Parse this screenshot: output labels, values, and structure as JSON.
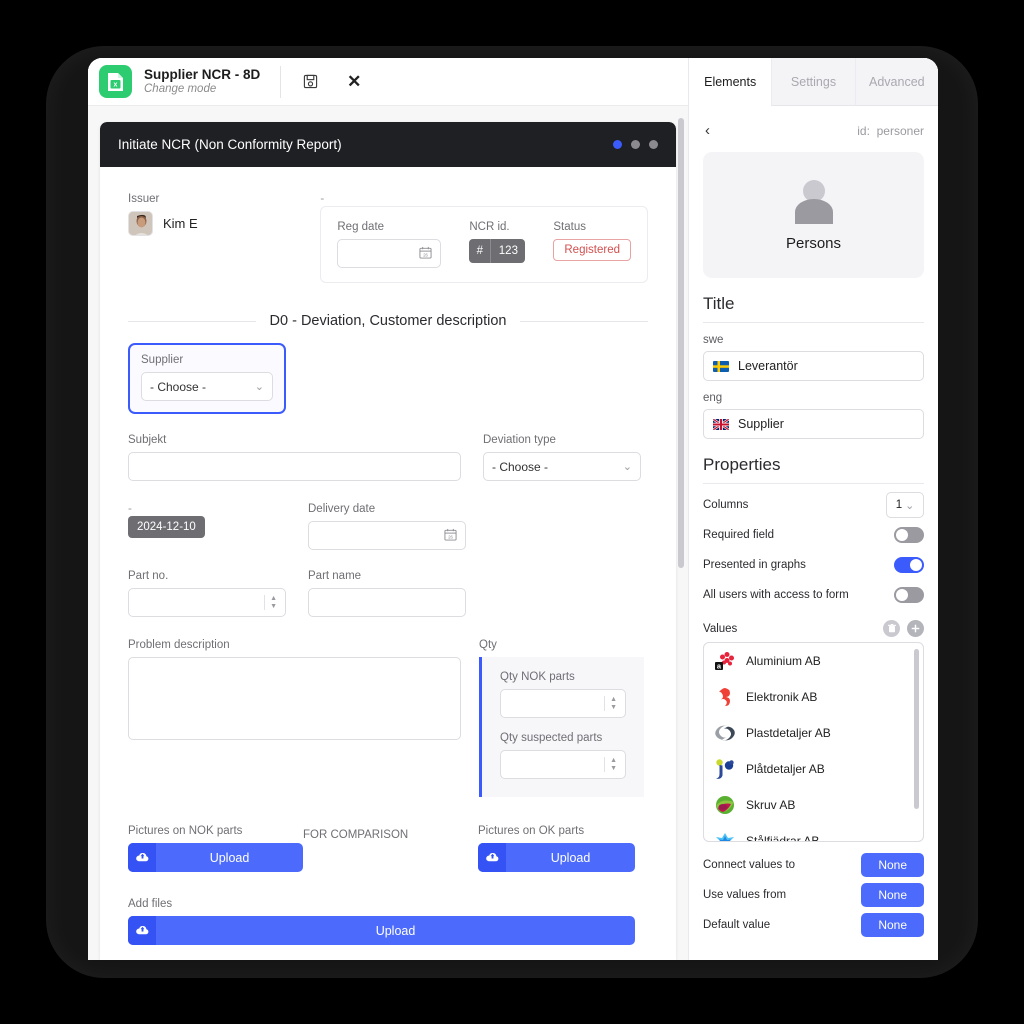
{
  "window": {
    "app_icon": "excel-document-icon",
    "title": "Supplier NCR - 8D",
    "subtitle": "Change mode",
    "save_icon": "save-floppy-icon",
    "close_icon": "close-x-icon"
  },
  "form": {
    "header_title": "Initiate NCR (Non Conformity Report)",
    "step_dots": [
      "active",
      "inactive",
      "inactive"
    ],
    "issuer": {
      "label": "Issuer",
      "name": "Kim E",
      "avatar": "user-photo-avatar"
    },
    "meta": {
      "dash_label": "-",
      "reg_date": {
        "label": "Reg date",
        "value": "",
        "icon": "calendar-icon"
      },
      "ncr_id": {
        "label": "NCR id.",
        "hash": "#",
        "value": "123"
      },
      "status": {
        "label": "Status",
        "value": "Registered",
        "color": "#d2504f"
      }
    },
    "section_d0": "D0 - Deviation, Customer description",
    "supplier": {
      "label": "Supplier",
      "value": "- Choose -",
      "highlighted": true
    },
    "subjekt": {
      "label": "Subjekt",
      "value": ""
    },
    "deviation_type": {
      "label": "Deviation type",
      "value": "- Choose -"
    },
    "reg_date_chip": {
      "label": "-",
      "value": "2024-12-10"
    },
    "delivery_date": {
      "label": "Delivery date",
      "value": "",
      "icon": "calendar-icon"
    },
    "part_no": {
      "label": "Part no.",
      "value": ""
    },
    "part_name": {
      "label": "Part name",
      "value": ""
    },
    "problem_description": {
      "label": "Problem description",
      "value": ""
    },
    "qty": {
      "label": "Qty",
      "nok": {
        "label": "Qty NOK parts",
        "value": ""
      },
      "suspected": {
        "label": "Qty suspected parts",
        "value": ""
      }
    },
    "uploads": {
      "nok_label": "Pictures on NOK parts",
      "comparison_label": "FOR COMPARISON",
      "ok_label": "Pictures on OK parts",
      "addfiles_label": "Add files",
      "upload_text": "Upload",
      "upload_icon": "cloud-upload-icon"
    }
  },
  "inspector": {
    "tabs": [
      {
        "label": "Elements",
        "active": true
      },
      {
        "label": "Settings",
        "active": false
      },
      {
        "label": "Advanced",
        "active": false
      }
    ],
    "back_icon": "chevron-left-icon",
    "id_prefix": "id:",
    "id_value": "personer",
    "element_card": {
      "icon": "person-icon",
      "name": "Persons"
    },
    "title_section": {
      "heading": "Title",
      "fields": [
        {
          "lang": "swe",
          "flag": "sweden-flag-icon",
          "value": "Leverantör"
        },
        {
          "lang": "eng",
          "flag": "uk-flag-icon",
          "value": "Supplier"
        }
      ]
    },
    "properties": {
      "heading": "Properties",
      "columns": {
        "label": "Columns",
        "value": "1",
        "icon": "chevron-down-icon"
      },
      "toggles": [
        {
          "label": "Required field",
          "on": false
        },
        {
          "label": "Presented in graphs",
          "on": true
        },
        {
          "label": "All users with access to form",
          "on": false
        }
      ]
    },
    "values": {
      "label": "Values",
      "delete_icon": "trash-icon",
      "add_icon": "plus-icon",
      "items": [
        {
          "name": "Aluminium AB",
          "logo": "aluminium-ab-logo"
        },
        {
          "name": "Elektronik AB",
          "logo": "elektronik-ab-logo"
        },
        {
          "name": "Plastdetaljer AB",
          "logo": "plastdetaljer-ab-logo"
        },
        {
          "name": "Plåtdetaljer AB",
          "logo": "platdetaljer-ab-logo"
        },
        {
          "name": "Skruv AB",
          "logo": "skruv-ab-logo"
        },
        {
          "name": "Stålfjädrar AB",
          "logo": "stalfjadrar-ab-logo"
        }
      ]
    },
    "links": [
      {
        "label": "Connect values to",
        "button": "None"
      },
      {
        "label": "Use values from",
        "button": "None"
      },
      {
        "label": "Default value",
        "button": "None"
      }
    ]
  },
  "colors": {
    "accent_blue": "#3b5bfd",
    "button_blue": "#4c6bfc",
    "app_green": "#2ecc71",
    "status_red": "#d2504f",
    "header_dark": "#1f2023"
  }
}
